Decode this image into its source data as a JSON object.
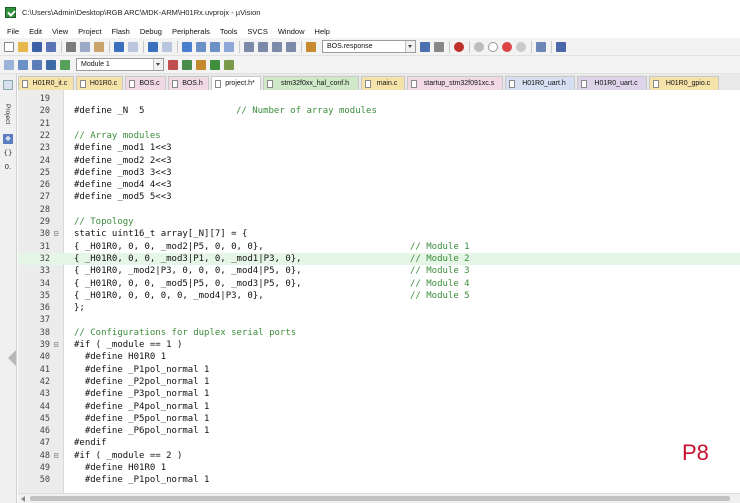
{
  "window": {
    "title": "C:\\Users\\Admin\\Desktop\\RGB ARC\\MDK-ARM\\H01Rx.uvprojx - µVision"
  },
  "menu": [
    "File",
    "Edit",
    "View",
    "Project",
    "Flash",
    "Debug",
    "Peripherals",
    "Tools",
    "SVCS",
    "Window",
    "Help"
  ],
  "toolbar": {
    "find_combo": "BOS.response",
    "target_combo": "Module 1"
  },
  "tabs": [
    {
      "label": "H01R0_it.c",
      "color": "#f6e3a9"
    },
    {
      "label": "H01R0.c",
      "color": "#f6e3a9"
    },
    {
      "label": "BOS.c",
      "color": "#f2d9e6"
    },
    {
      "label": "BOS.h",
      "color": "#f2d9e6"
    },
    {
      "label": "project.h*",
      "color": "#ffffff"
    },
    {
      "label": "stm32f0xx_hal_conf.h",
      "color": "#cfe8c8"
    },
    {
      "label": "main.c",
      "color": "#f6e3a9"
    },
    {
      "label": "startup_stm32f091xc.s",
      "color": "#f2d9e6"
    },
    {
      "label": "H01R0_uart.h",
      "color": "#d7dff2"
    },
    {
      "label": "H01R0_uart.c",
      "color": "#ddd4ea"
    },
    {
      "label": "H01R0_gpio.c",
      "color": "#f6e3a9"
    }
  ],
  "side_panel": {
    "label": "Project"
  },
  "code_lines": [
    {
      "n": "19",
      "fold": "",
      "code": "",
      "comment": ""
    },
    {
      "n": "20",
      "fold": "",
      "code": "#define _N  5",
      "comment": "// Number of array modules"
    },
    {
      "n": "21",
      "fold": "",
      "code": "",
      "comment": ""
    },
    {
      "n": "22",
      "fold": "",
      "code": "// Array modules",
      "comment": ""
    },
    {
      "n": "23",
      "fold": "",
      "code": "#define _mod1 1<<3",
      "comment": ""
    },
    {
      "n": "24",
      "fold": "",
      "code": "#define _mod2 2<<3",
      "comment": ""
    },
    {
      "n": "25",
      "fold": "",
      "code": "#define _mod3 3<<3",
      "comment": ""
    },
    {
      "n": "26",
      "fold": "",
      "code": "#define _mod4 4<<3",
      "comment": ""
    },
    {
      "n": "27",
      "fold": "",
      "code": "#define _mod5 5<<3",
      "comment": ""
    },
    {
      "n": "28",
      "fold": "",
      "code": "",
      "comment": ""
    },
    {
      "n": "29",
      "fold": "",
      "code": "// Topology",
      "comment": ""
    },
    {
      "n": "30",
      "fold": "⊟",
      "code": "static uint16_t array[_N][7] = {",
      "comment": ""
    },
    {
      "n": "31",
      "fold": "",
      "code": "{ _H01R0, 0, 0, _mod2|P5, 0, 0, 0},",
      "comment": "// Module 1"
    },
    {
      "n": "32",
      "fold": "",
      "code": "{ _H01R0, 0, 0, _mod3|P1, 0, _mod1|P3, 0},",
      "comment": "// Module 2",
      "hl": true
    },
    {
      "n": "33",
      "fold": "",
      "code": "{ _H01R0, _mod2|P3, 0, 0, 0, _mod4|P5, 0},",
      "comment": "// Module 3"
    },
    {
      "n": "34",
      "fold": "",
      "code": "{ _H01R0, 0, 0, _mod5|P5, 0, _mod3|P5, 0},",
      "comment": "// Module 4"
    },
    {
      "n": "35",
      "fold": "",
      "code": "{ _H01R0, 0, 0, 0, 0, _mod4|P3, 0},",
      "comment": "// Module 5"
    },
    {
      "n": "36",
      "fold": "",
      "code": "};",
      "comment": ""
    },
    {
      "n": "37",
      "fold": "",
      "code": "",
      "comment": ""
    },
    {
      "n": "38",
      "fold": "",
      "code": "// Configurations for duplex serial ports",
      "comment": ""
    },
    {
      "n": "39",
      "fold": "⊟",
      "code": "#if ( _module == 1 )",
      "comment": ""
    },
    {
      "n": "40",
      "fold": "",
      "code": "  #define H01R0 1",
      "comment": ""
    },
    {
      "n": "41",
      "fold": "",
      "code": "  #define _P1pol_normal 1",
      "comment": ""
    },
    {
      "n": "42",
      "fold": "",
      "code": "  #define _P2pol_normal 1",
      "comment": ""
    },
    {
      "n": "43",
      "fold": "",
      "code": "  #define _P3pol_normal 1",
      "comment": ""
    },
    {
      "n": "44",
      "fold": "",
      "code": "  #define _P4pol_normal 1",
      "comment": ""
    },
    {
      "n": "45",
      "fold": "",
      "code": "  #define _P5pol_normal 1",
      "comment": ""
    },
    {
      "n": "46",
      "fold": "",
      "code": "  #define _P6pol_normal 1",
      "comment": ""
    },
    {
      "n": "47",
      "fold": "",
      "code": "#endif",
      "comment": ""
    },
    {
      "n": "48",
      "fold": "⊟",
      "code": "#if ( _module == 2 )",
      "comment": ""
    },
    {
      "n": "49",
      "fold": "",
      "code": "  #define H01R0 1",
      "comment": ""
    },
    {
      "n": "50",
      "fold": "",
      "code": "  #define _P1pol_normal 1",
      "comment": ""
    }
  ],
  "overlay": {
    "label": "P8",
    "color": "#c8102e"
  }
}
